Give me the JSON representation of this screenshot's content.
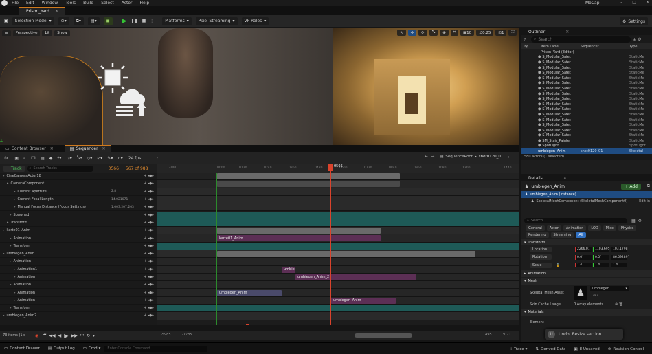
{
  "menubar": {
    "items": [
      "File",
      "Edit",
      "Window",
      "Tools",
      "Build",
      "Select",
      "Actor",
      "Help"
    ],
    "project_name": "MoCap"
  },
  "tabs": {
    "level_tab": "Prison_Yard"
  },
  "toolbar": {
    "selection_mode": "Selection Mode",
    "platforms": "Platforms",
    "pixel_streaming": "Pixel Streaming",
    "vp_roles": "VP Roles",
    "settings": "Settings"
  },
  "viewport": {
    "perspective": "Perspective",
    "lit": "Lit",
    "show": "Show",
    "fov": "0.25",
    "grid": "10",
    "scale": "1"
  },
  "bottom_tabs": {
    "content_browser": "Content Browser",
    "sequencer": "Sequencer"
  },
  "sequencer": {
    "fps": "24 fps",
    "breadcrumb_root": "SequenceRoot",
    "breadcrumb_shot": "shot0120_01",
    "track_button": "+ Track",
    "search_placeholder": "Search Tracks",
    "current_frame": "0566",
    "frame_counter": "567 of 988",
    "playhead_label": "0566",
    "items_count": "73 items (1 s",
    "range_start": "-5985",
    "range_start2": "-7785",
    "range_end": "1495",
    "range_end2": "3021",
    "ruler_ticks": [
      "-240",
      "0000",
      "0120",
      "0240",
      "0360",
      "0480",
      "0600",
      "0720",
      "0840",
      "0960",
      "1080",
      "1200",
      "1440"
    ],
    "tracks": [
      {
        "label": "CineCameraActor18",
        "indent": 4
      },
      {
        "label": "CameraComponent",
        "indent": 10
      },
      {
        "label": "Current Aperture",
        "indent": 20,
        "value": "2.8"
      },
      {
        "label": "Current Focal Length",
        "indent": 20,
        "value": "14.021071"
      },
      {
        "label": "Manual Focus Distance (Focus Settings)",
        "indent": 20,
        "value": "1,003,207,203"
      },
      {
        "label": "Spawned",
        "indent": 14
      },
      {
        "label": "Transform",
        "indent": 10
      },
      {
        "label": "karte01_Anim",
        "indent": 4
      },
      {
        "label": "Animation",
        "indent": 14
      },
      {
        "label": "Transform",
        "indent": 14
      },
      {
        "label": "umbiegen_Anim",
        "indent": 4
      },
      {
        "label": "Animation",
        "indent": 14
      },
      {
        "label": "Animation1",
        "indent": 20
      },
      {
        "label": "Animation",
        "indent": 20
      },
      {
        "label": "Animation",
        "indent": 14
      },
      {
        "label": "Animation",
        "indent": 20
      },
      {
        "label": "Animation",
        "indent": 20
      },
      {
        "label": "Transform",
        "indent": 14
      },
      {
        "label": "umbiegen_Anim2",
        "indent": 4
      }
    ],
    "sections": {
      "karte": "karte01_Anim",
      "umbie": "umbie",
      "umbiegen2": "umbiegen_Anim_2",
      "umbiegen_a": "umbiegen_Anim",
      "umbiegen_b": "umbiegen_Anim"
    }
  },
  "outliner": {
    "title": "Outliner",
    "search_placeholder": "Search",
    "col_label": "Item Label",
    "col_sequencer": "Sequencer",
    "col_type": "Type",
    "root": "Prison_Yard (Editor)",
    "items": [
      {
        "label": "S_Modular_Safet",
        "type": "StaticMe"
      },
      {
        "label": "S_Modular_Safet",
        "type": "StaticMe"
      },
      {
        "label": "S_Modular_Safet",
        "type": "StaticMe"
      },
      {
        "label": "S_Modular_Safet",
        "type": "StaticMe"
      },
      {
        "label": "S_Modular_Safet",
        "type": "StaticMe"
      },
      {
        "label": "S_Modular_Safet",
        "type": "StaticMe"
      },
      {
        "label": "S_Modular_Safet",
        "type": "StaticMe"
      },
      {
        "label": "S_Modular_Safet",
        "type": "StaticMe"
      },
      {
        "label": "S_Modular_Safet",
        "type": "StaticMe"
      },
      {
        "label": "S_Modular_Safet",
        "type": "StaticMe"
      },
      {
        "label": "S_Modular_Safet",
        "type": "StaticMe"
      },
      {
        "label": "S_Modular_Safet",
        "type": "StaticMe"
      },
      {
        "label": "S_Modular_Safet",
        "type": "StaticMe"
      },
      {
        "label": "S_Modular_Safet",
        "type": "StaticMe"
      },
      {
        "label": "S_Modular_Safet",
        "type": "StaticMe"
      },
      {
        "label": "S_Modular_Safet",
        "type": "StaticMe"
      },
      {
        "label": "SM_Stair_Painter",
        "type": "StaticMe"
      },
      {
        "label": "SpotLight",
        "type": "SpotLight"
      }
    ],
    "selected": {
      "label": "umbiegen_Anim",
      "seq": "shot0120_01",
      "type": "Skeletal"
    },
    "count": "580 actors (1 selected)"
  },
  "details": {
    "title": "Details",
    "actor": "umbiegen_Anim",
    "add": "+ Add",
    "instance": "umbiegen_Anim (Instance)",
    "component": "SkeletalMeshComponent (SkeletalMeshComponent0)",
    "edit_in": "Edit in",
    "search_placeholder": "Search",
    "filters": [
      "General",
      "Actor",
      "Animation",
      "LOD",
      "Misc",
      "Physics",
      "Rendering",
      "Streaming",
      "All"
    ],
    "transform_header": "Transform",
    "location_label": "Location",
    "location": [
      "2266.01",
      "1103.695",
      "103.1798"
    ],
    "rotation_label": "Rotation",
    "rotation": [
      "0.0°",
      "0.0°",
      "86.69289°"
    ],
    "scale_label": "Scale",
    "scale": [
      "1.4",
      "1.4",
      "1.4"
    ],
    "animation_header": "Animation",
    "mesh_header": "Mesh",
    "skeletal_mesh_label": "Skeletal Mesh Asset",
    "skeletal_mesh_value": "umbiegen",
    "skin_cache_label": "Skin Cache Usage",
    "skin_cache_value": "0 Array elements",
    "materials_header": "Materials",
    "element_label": "Element",
    "undo_toast": "Undo: Resize section"
  },
  "statusbar": {
    "content_drawer": "Content Drawer",
    "output_log": "Output Log",
    "cmd": "Cmd",
    "console_placeholder": "Enter Console Command",
    "trace": "Trace",
    "derived_data": "Derived Data",
    "unsaved": "8 Unsaved",
    "revision": "Revision Control"
  },
  "colors": {
    "accent": "#d07a1e",
    "selected": "#1f4c82",
    "playhead": "#d9432c",
    "teal": "#1e5a57",
    "purple": "#5c2f55",
    "grey": "#6a6a6a"
  }
}
